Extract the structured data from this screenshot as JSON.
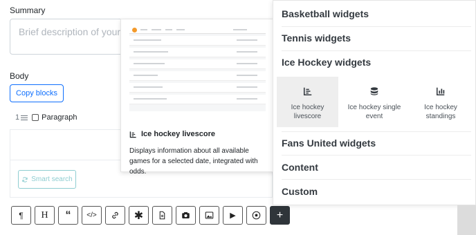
{
  "summary": {
    "label": "Summary",
    "placeholder": "Brief description of your c"
  },
  "body": {
    "label": "Body",
    "copy_blocks": "Copy blocks"
  },
  "paragraph": {
    "number": "1",
    "label": "Paragraph"
  },
  "smart_search": {
    "label": "Smart search"
  },
  "toolbar": {
    "buttons": [
      "paragraph",
      "heading",
      "quote",
      "code",
      "link",
      "asterisk",
      "document",
      "camera",
      "image",
      "video",
      "football",
      "add"
    ]
  },
  "preview": {
    "title": "Ice hockey livescore",
    "description": "Displays information about all available games for a selected date, integrated with odds."
  },
  "menu": {
    "sections": [
      "Basketball widgets",
      "Tennis widgets",
      "Ice Hockey widgets",
      "Fans United widgets",
      "Content",
      "Custom"
    ],
    "ice_hockey_widgets": [
      {
        "label": "Ice hockey livescore",
        "icon": "list-icon",
        "active": true
      },
      {
        "label": "Ice hockey single event",
        "icon": "database-icon",
        "active": false
      },
      {
        "label": "Ice hockey standings",
        "icon": "bar-chart-icon",
        "active": false
      }
    ]
  },
  "colors": {
    "accent": "#0d6efd",
    "teal": "#8ecdd1",
    "dark_button": "#2f353a"
  }
}
